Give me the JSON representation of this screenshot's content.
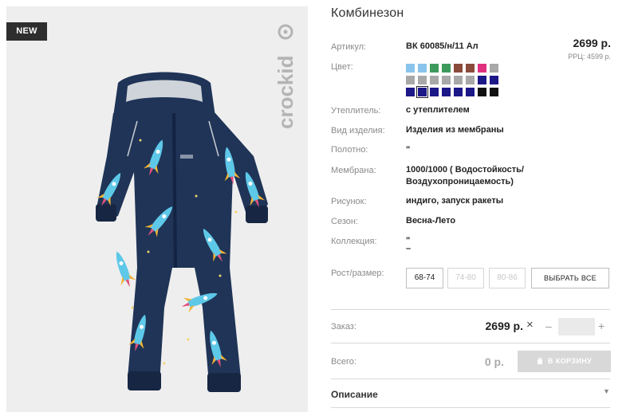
{
  "product": {
    "badge": "NEW",
    "brand": "crockid",
    "title": "Комбинезон",
    "price": "2699 р.",
    "rrp": "РРЦ: 4599 р."
  },
  "specs": {
    "article_label": "Артикул:",
    "article_value": "ВК 60085/н/11 Ал",
    "color_label": "Цвет:",
    "insulation_label": "Утеплитель:",
    "insulation_value": "с утеплителем",
    "type_label": "Вид изделия:",
    "type_value": "Изделия из мембраны",
    "fabric_label": "Полотно:",
    "fabric_value": "\"",
    "membrane_label": "Мембрана:",
    "membrane_value_1": "1000/1000 ( Водостойкость/",
    "membrane_value_2": "Воздухопроницаемость)",
    "pattern_label": "Рисунок:",
    "pattern_value": "индиго, запуск ракеты",
    "season_label": "Сезон:",
    "season_value": "Весна-Лето",
    "collection_label": "Коллекция:",
    "collection_value_1": "\"",
    "collection_value_2": "–"
  },
  "colors": [
    [
      "#89c4ec",
      "#89c4ec",
      "#3d9a5c",
      "#3d9a5c",
      "#8b4b3a",
      "#8b4b3a",
      "#e0317f",
      "#a8a8a8"
    ],
    [
      "#a8a8a8",
      "#a8a8a8",
      "#a8a8a8",
      "#a8a8a8",
      "#a8a8a8",
      "#a8a8a8",
      "#1c1888",
      "#1c1888"
    ],
    [
      "#1c1888",
      "#1c1888",
      "#1c1888",
      "#1c1888",
      "#1c1888",
      "#1c1888",
      "#111111",
      "#111111"
    ]
  ],
  "selected_color": [
    2,
    1
  ],
  "sizes": {
    "label": "Рост/размер:",
    "options": [
      "68-74",
      "74-80",
      "80-86"
    ],
    "select_all": "ВЫБРАТЬ ВСЕ"
  },
  "order": {
    "label": "Заказ:",
    "price": "2699 р.",
    "remove_icon": "×",
    "minus": "–",
    "plus": "+",
    "quantity": ""
  },
  "total": {
    "label": "Всего:",
    "price": "0 р.",
    "cart_button": "В КОРЗИНУ"
  },
  "description": {
    "label": "Описание"
  }
}
